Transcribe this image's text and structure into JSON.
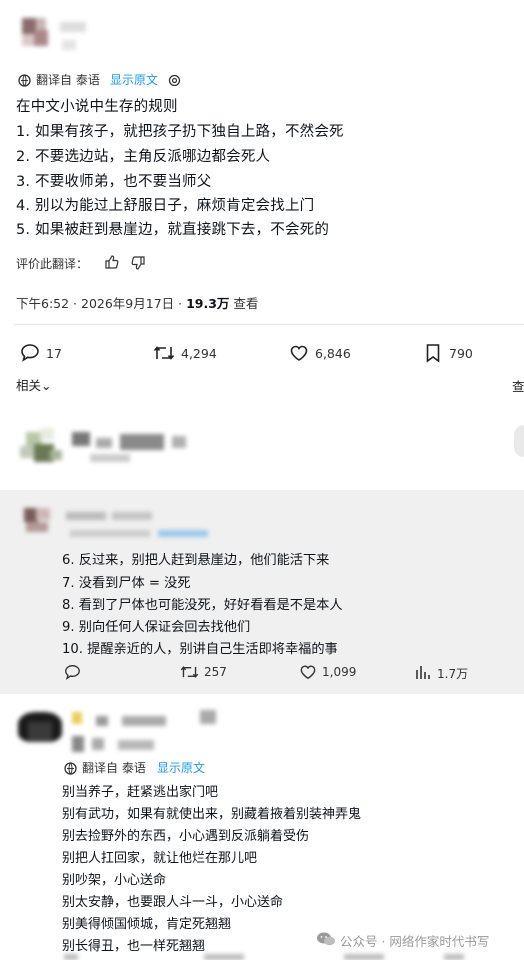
{
  "tweet1": {
    "translation_label": "翻译自 泰语",
    "show_original": "显示原文",
    "lines": [
      "在中文小说中生存的规则",
      "1. 如果有孩子，就把孩子扔下独自上路，不然会死",
      "2. 不要选边站，主角反派哪边都会死人",
      "3. 不要收师弟，也不要当师父",
      "4. 别以为能过上舒服日子，麻烦肯定会找上门",
      "5. 如果被赶到悬崖边，就直接跳下去，不会死的"
    ],
    "rate_translation": "评价此翻译：",
    "time": "下午6:52 · 2026年9月17日 · ",
    "views": "19.3万",
    "views_label": "查看",
    "stats": {
      "replies": "17",
      "retweets": "4,294",
      "likes": "6,846",
      "bookmarks": "790"
    },
    "related": "相关",
    "related_chevron": "⌄",
    "right_cut": "查"
  },
  "tweet2": {
    "lines": [
      "6. 反过来，别把人赶到悬崖边，他们能活下来",
      "7. 没看到尸体 = 没死",
      "8. 看到了尸体也可能没死，好好看看是不是本人",
      "9. 别向任何人保证会回去找他们",
      "10. 提醒亲近的人，别讲自己生活即将幸福的事"
    ],
    "stats": {
      "retweets": "257",
      "likes": "1,099",
      "views": "1.7万"
    }
  },
  "tweet3": {
    "translation_label": "翻译自 泰语",
    "show_original": "显示原文",
    "lines": [
      "别当养子，赶紧逃出家门吧",
      "别有武功，如果有就使出来，别藏着掖着别装神弄鬼",
      "别去捡野外的东西，小心遇到反派躺着受伤",
      "别把人扛回家，就让他烂在那儿吧",
      "别吵架，小心送命",
      "别太安静，也要跟人斗一斗，小心送命",
      "别美得倾国倾城，肯定死翘翘",
      "别长得丑，也一样死翘翘"
    ]
  },
  "watermark": "公众号 · 网络作家时代书写",
  "colors": {
    "accent": "#1d9bf0",
    "text": "#0f1419",
    "gray_bg": "#f0f0f0"
  }
}
